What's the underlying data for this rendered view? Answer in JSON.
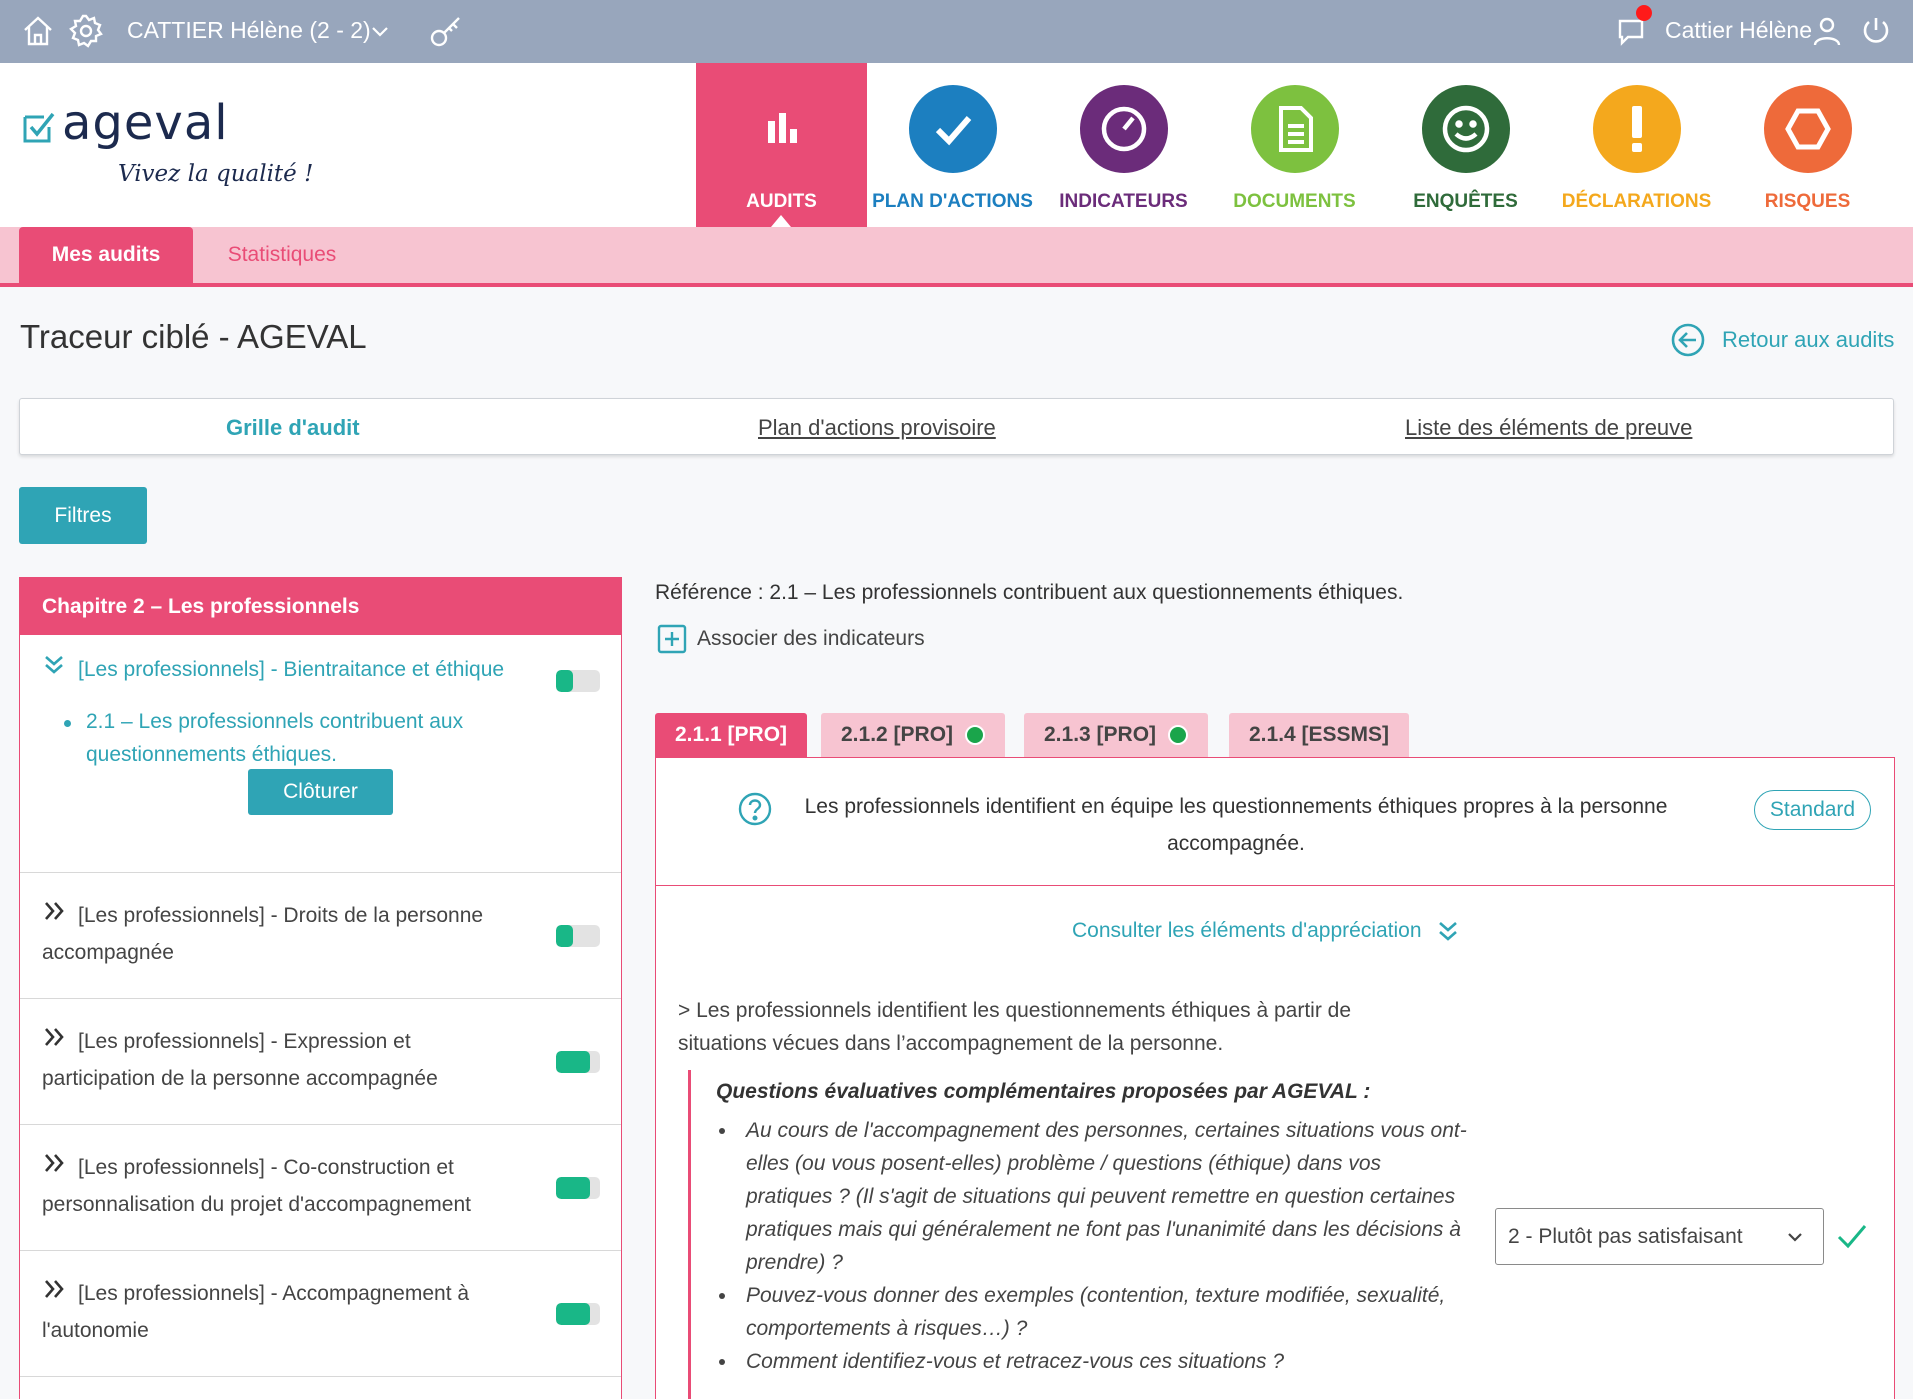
{
  "topbar": {
    "user_context": "CATTIER Hélène (2 - 2)",
    "user_name": "Cattier Hélène",
    "icons": [
      "home-icon",
      "gear-icon",
      "chevron-down-icon",
      "key-icon",
      "notification-icon",
      "user-icon",
      "power-icon"
    ]
  },
  "logo": {
    "word": "ageval",
    "tagline": "Vivez la qualité !"
  },
  "modules": [
    {
      "label": "AUDITS",
      "color": "#e94c76",
      "icon": "bar-chart-icon",
      "active": true
    },
    {
      "label": "PLAN D'ACTIONS",
      "color": "#1c7fc0",
      "icon": "check-icon"
    },
    {
      "label": "INDICATEURS",
      "color": "#6b2c7a",
      "icon": "gauge-icon"
    },
    {
      "label": "DOCUMENTS",
      "color": "#7dc13f",
      "icon": "document-icon"
    },
    {
      "label": "ENQUÊTES",
      "color": "#2f6b3a",
      "icon": "smiley-icon"
    },
    {
      "label": "DÉCLARATIONS",
      "color": "#f4a81d",
      "icon": "exclamation-icon"
    },
    {
      "label": "RISQUES",
      "color": "#ee6a3a",
      "icon": "hexagon-icon"
    }
  ],
  "subnav": {
    "active": "Mes audits",
    "inactive": "Statistiques"
  },
  "page": {
    "title": "Traceur ciblé - AGEVAL",
    "back_label": "Retour aux audits"
  },
  "tabs": {
    "grille": "Grille d'audit",
    "plan": "Plan d'actions provisoire",
    "liste": "Liste des éléments de preuve"
  },
  "filters_label": "Filtres",
  "left": {
    "chapter": "Chapitre 2 – Les professionnels",
    "items": [
      {
        "label": "[Les professionnels] - Bientraitance et éthique",
        "progress": 0.5,
        "expanded": true
      },
      {
        "label": "[Les professionnels] - Droits de la personne accompagnée",
        "progress": 0.5
      },
      {
        "label": "[Les professionnels] - Expression et participation de la personne accompagnée",
        "progress": 1.0
      },
      {
        "label": "[Les professionnels] - Co-construction et personnalisation du projet d'accompagnement",
        "progress": 1.0
      },
      {
        "label": "[Les professionnels] - Accompagnement à l'autonomie",
        "progress": 1.0
      }
    ],
    "sub_item": "2.1 – Les professionnels contribuent aux questionnements éthiques.",
    "close_label": "Clôturer"
  },
  "right": {
    "reference": "Référence : 2.1 – Les professionnels contribuent aux questionnements éthiques.",
    "associate": "Associer des indicateurs",
    "subtabs": [
      {
        "label": "2.1.1 [PRO]",
        "active": true
      },
      {
        "label": "2.1.2 [PRO]",
        "done": true
      },
      {
        "label": "2.1.3 [PRO]",
        "done": true
      },
      {
        "label": "2.1.4 [ESSMS]"
      }
    ],
    "criterion": "Les professionnels identifient en équipe les questionnements éthiques propres à la personne accompagnée.",
    "standard": "Standard",
    "consult": "Consulter les éléments d'appréciation",
    "paragraph": "> Les professionnels identifient les questionnements éthiques à partir de situations vécues dans l’accompagnement de la personne.",
    "questions_title": "Questions évaluatives complémentaires proposées par AGEVAL :",
    "questions": [
      "Au cours de l'accompagnement des personnes, certaines situations vous ont-elles (ou vous posent-elles) problème / questions (éthique) dans vos pratiques ? (Il s'agit de situations qui peuvent remettre en question certaines pratiques mais qui généralement ne font pas l'unanimité dans les décisions à prendre) ?",
      "Pouvez-vous donner des exemples (contention, texture modifiée, sexualité, comportements à risques…) ?",
      "Comment identifiez-vous et retracez-vous ces situations ?"
    ],
    "selected_answer": "2 - Plutôt pas satisfaisant"
  }
}
